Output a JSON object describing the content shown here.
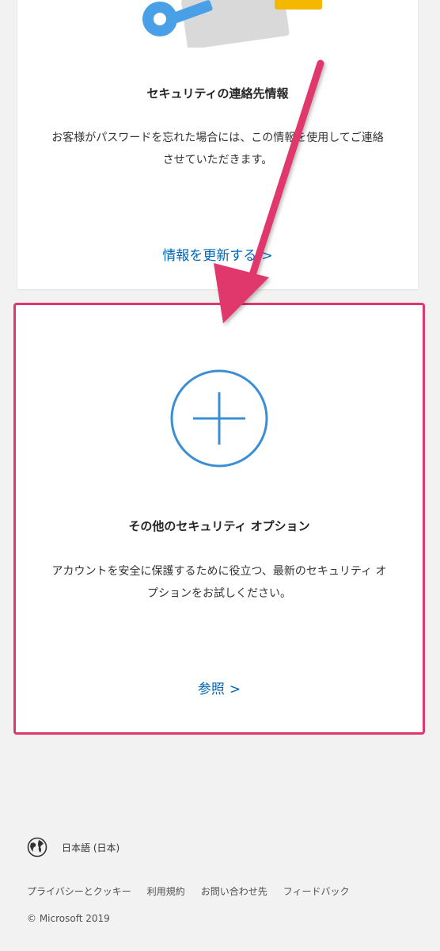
{
  "contact_card": {
    "title": "セキュリティの連絡先情報",
    "description": "お客様がパスワードを忘れた場合には、この情報を使用してご連絡させていただきます。",
    "link_label": "情報を更新する",
    "link_chevron": ">",
    "illustration_icon": "key-icon"
  },
  "more_options_card": {
    "title": "その他のセキュリティ オプション",
    "description": "アカウントを安全に保護するために役立つ、最新のセキュリティ オプションをお試しください。",
    "link_label": "参照",
    "link_chevron": ">",
    "icon": "plus-circle-icon",
    "highlight_color": "#e0376c"
  },
  "footer": {
    "language": "日本語 (日本)",
    "language_icon": "globe-icon",
    "links": [
      "プライバシーとクッキー",
      "利用規約",
      "お問い合わせ先",
      "フィードバック"
    ],
    "copyright": "© Microsoft 2019"
  },
  "colors": {
    "accent_blue": "#0067b8",
    "annotation_pink": "#e0376c",
    "background": "#f2f2f2"
  }
}
